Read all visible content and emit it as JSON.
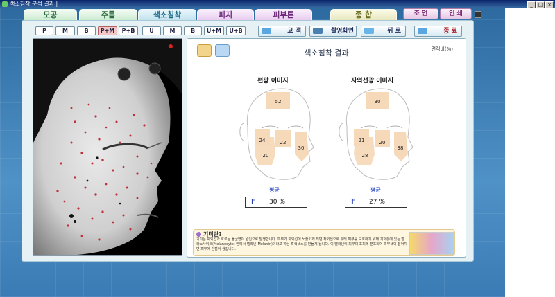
{
  "window": {
    "title": "색소침착 분석 결과 |",
    "min_glyph": "_",
    "max_glyph": "□",
    "close_glyph": "×"
  },
  "tabs": [
    {
      "label": "모공"
    },
    {
      "label": "주름"
    },
    {
      "label": "색소침착"
    },
    {
      "label": "피지"
    },
    {
      "label": "피부톤"
    },
    {
      "label": "종 합"
    }
  ],
  "top_buttons": {
    "settings": "조 언",
    "print": "인 쇄"
  },
  "filters": {
    "left": [
      "P",
      "M",
      "B",
      "P+M",
      "P+B"
    ],
    "left_selected": "P+M",
    "right": [
      "U",
      "M",
      "B",
      "U+M",
      "U+B"
    ]
  },
  "nav": {
    "customer": "고 객",
    "capture_screen": "촬영화면",
    "back": "뒤 로",
    "exit": "종 료"
  },
  "result": {
    "title": "색소침착 결과",
    "area_ratio_label": "면적비(%)",
    "polarized": {
      "title": "편광 이미지",
      "forehead": "52",
      "left_cheek": "24",
      "nose": "22",
      "lower_cheek": "20",
      "right_cheek": "30",
      "avg_label": "평균",
      "grade": "F",
      "avg_value": "30 %"
    },
    "uv": {
      "title": "자외선광 이미지",
      "forehead": "30",
      "left_cheek": "21",
      "nose": "20",
      "lower_cheek": "28",
      "right_cheek": "38",
      "avg_label": "평균",
      "grade": "F",
      "avg_value": "27 %"
    }
  },
  "info": {
    "question": "기미란?",
    "description": "기미는 자외선과 호르몬 불균형이 원인으로 발생합니다. 피부가 자외선에 노출되게 되면 자외선으로 부터 피부를 보호하기 위해 기저층에 있는 멜라노사이트(Melanocyte) 안에서 멜라닌(Melanin)이라고 하는 흑색색소를 만들게 됩니다. 이 멜라닌이 피부의 표피에 분포되어 피부색이 짙어지면 피부에 반점이 생깁니다."
  },
  "colors": {
    "app_blue": "#3b7bb5",
    "filter_selected": "#f3c7c5",
    "grade_blue": "#2540b0",
    "region_fill": "#f6d9b9"
  }
}
